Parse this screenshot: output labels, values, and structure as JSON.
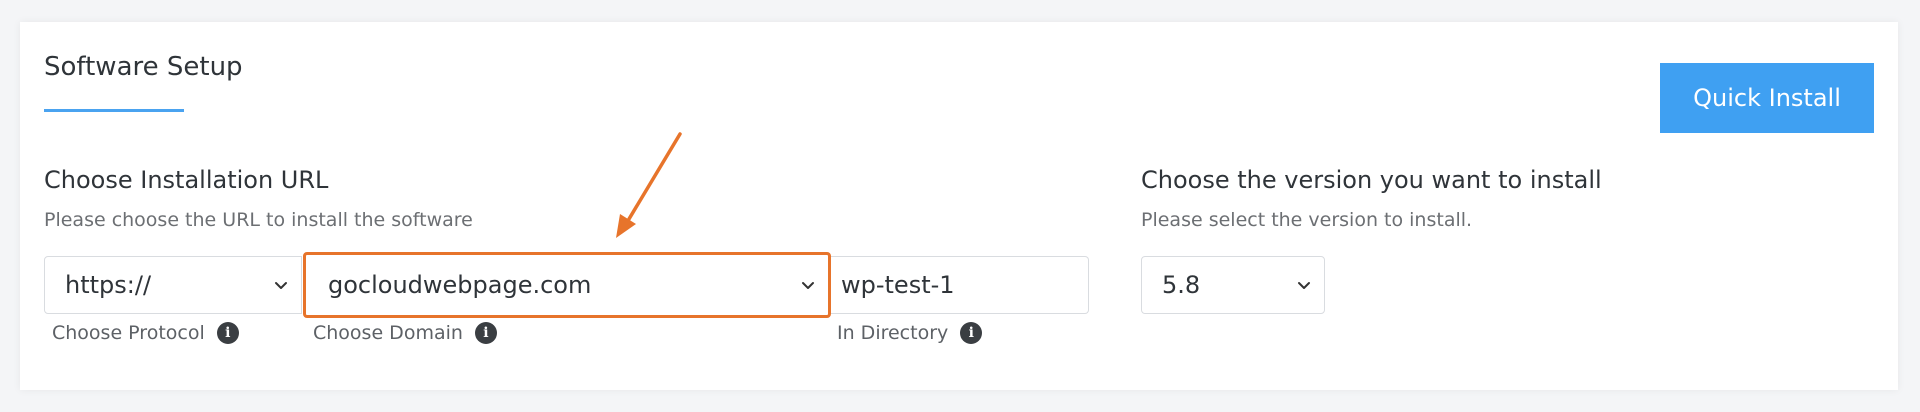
{
  "title": "Software Setup",
  "quick_install_label": "Quick Install",
  "url_section": {
    "title": "Choose Installation URL",
    "subtitle": "Please choose the URL to install the software",
    "protocol": {
      "value": "https://",
      "label": "Choose Protocol"
    },
    "domain": {
      "value": "gocloudwebpage.com",
      "label": "Choose Domain"
    },
    "directory": {
      "value": "wp-test-1",
      "label": "In Directory"
    }
  },
  "version_section": {
    "title": "Choose the version you want to install",
    "subtitle": "Please select the version to install.",
    "version": {
      "value": "5.8"
    }
  },
  "colors": {
    "accent": "#3fa0f2",
    "highlight": "#e7742b"
  },
  "icons": [
    "chevron-down-icon",
    "info-icon",
    "annotation-arrow"
  ]
}
